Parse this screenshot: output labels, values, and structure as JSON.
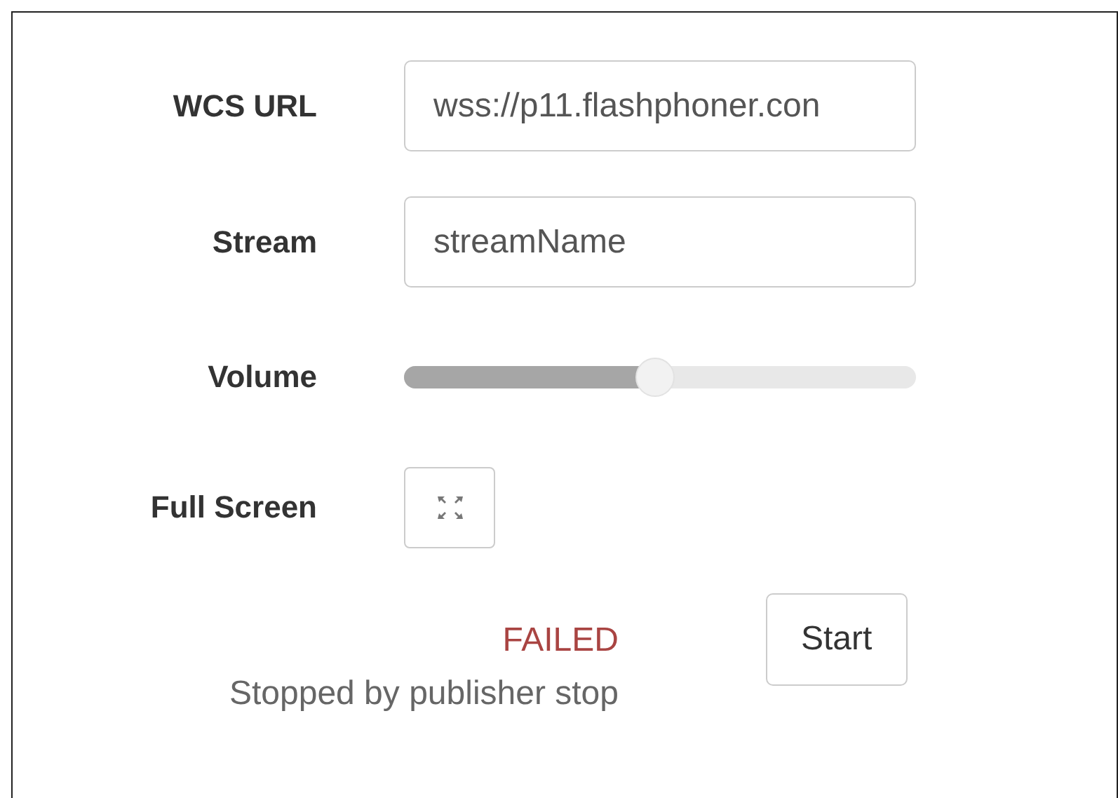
{
  "fields": [
    {
      "kind": "text",
      "label": "WCS URL",
      "value": "wss://p11.flashphoner.con"
    },
    {
      "kind": "text",
      "label": "Stream",
      "value": "streamName"
    },
    {
      "kind": "slider",
      "label": "Volume",
      "level": 0.49
    },
    {
      "kind": "icon-button",
      "label": "Full Screen"
    }
  ],
  "status": {
    "state": "FAILED",
    "message": "Stopped by publisher stop"
  },
  "buttons": [
    "Start"
  ]
}
